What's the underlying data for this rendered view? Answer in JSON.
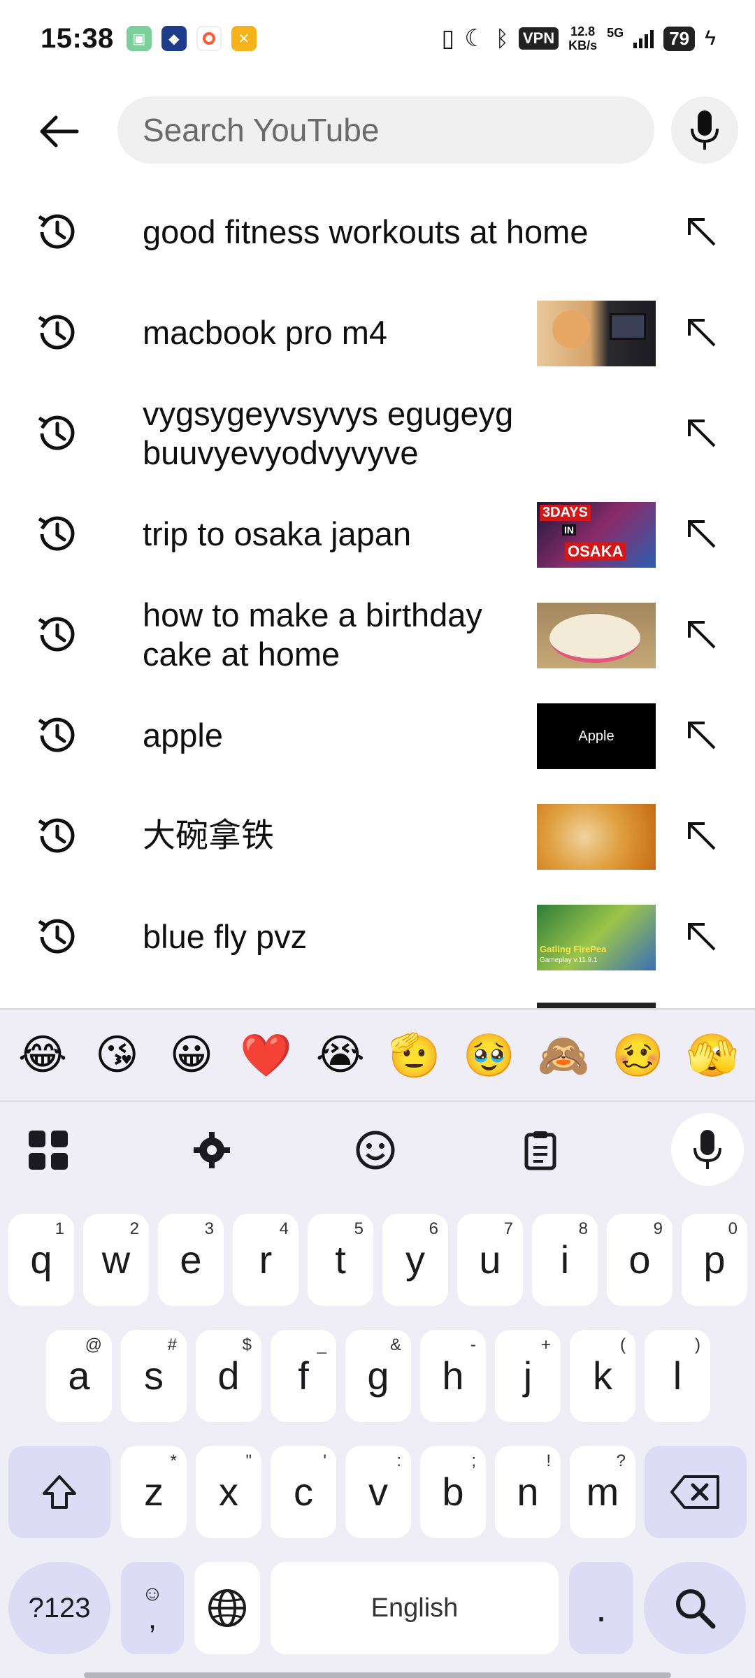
{
  "status_bar": {
    "time": "15:38",
    "vpn": "VPN",
    "speed_value": "12.8",
    "speed_unit": "KB/s",
    "network": "5G",
    "battery": "79"
  },
  "search": {
    "placeholder": "Search YouTube"
  },
  "suggestions": [
    {
      "text": "good fitness workouts at home",
      "has_thumb": false
    },
    {
      "text": "macbook pro m4",
      "has_thumb": true
    },
    {
      "text": "vygsygeyvsyvys egugeyg buuvyevyodvyvyve",
      "has_thumb": false
    },
    {
      "text": "trip to osaka japan",
      "has_thumb": true,
      "thumb_text_top": "3DAYS",
      "thumb_text_mid": "IN",
      "thumb_text_bottom": "OSAKA"
    },
    {
      "text": "how to make a birthday cake at home",
      "has_thumb": true
    },
    {
      "text": "apple",
      "has_thumb": true,
      "thumb_text": "Apple"
    },
    {
      "text": "大碗拿铁",
      "has_thumb": true
    },
    {
      "text": "blue fly pvz",
      "has_thumb": true,
      "thumb_text": "Gatling FirePea",
      "thumb_subtext": "Gameplay v.11.9.1"
    }
  ],
  "keyboard": {
    "emojis": [
      "😂",
      "😘",
      "😀",
      "❤️",
      "😭",
      "🫡",
      "🥹",
      "🙈",
      "🥴",
      "🫣"
    ],
    "row1": [
      {
        "key": "q",
        "hint": "1"
      },
      {
        "key": "w",
        "hint": "2"
      },
      {
        "key": "e",
        "hint": "3"
      },
      {
        "key": "r",
        "hint": "4"
      },
      {
        "key": "t",
        "hint": "5"
      },
      {
        "key": "y",
        "hint": "6"
      },
      {
        "key": "u",
        "hint": "7"
      },
      {
        "key": "i",
        "hint": "8"
      },
      {
        "key": "o",
        "hint": "9"
      },
      {
        "key": "p",
        "hint": "0"
      }
    ],
    "row2": [
      {
        "key": "a",
        "hint": "@"
      },
      {
        "key": "s",
        "hint": "#"
      },
      {
        "key": "d",
        "hint": "$"
      },
      {
        "key": "f",
        "hint": "_"
      },
      {
        "key": "g",
        "hint": "&"
      },
      {
        "key": "h",
        "hint": "-"
      },
      {
        "key": "j",
        "hint": "+"
      },
      {
        "key": "k",
        "hint": "("
      },
      {
        "key": "l",
        "hint": ")"
      }
    ],
    "row3": [
      {
        "key": "z",
        "hint": "*"
      },
      {
        "key": "x",
        "hint": "\""
      },
      {
        "key": "c",
        "hint": "'"
      },
      {
        "key": "v",
        "hint": ":"
      },
      {
        "key": "b",
        "hint": ";"
      },
      {
        "key": "n",
        "hint": "!"
      },
      {
        "key": "m",
        "hint": "?"
      }
    ],
    "symbols_key": "?123",
    "comma_key": ",",
    "space_label": "English",
    "period_key": "."
  }
}
